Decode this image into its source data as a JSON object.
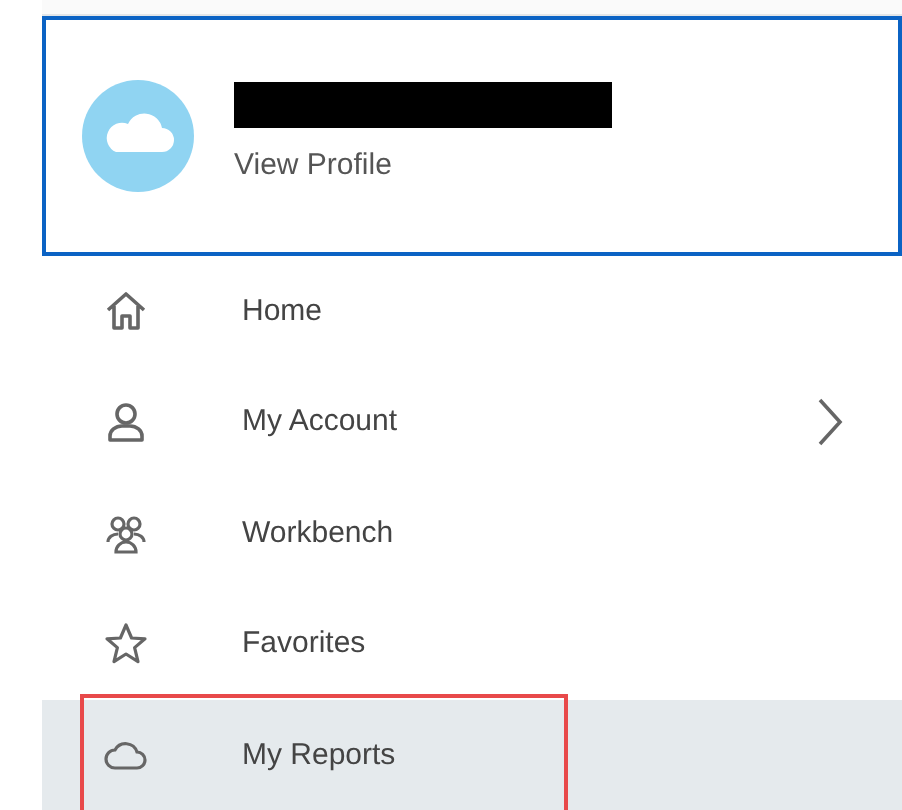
{
  "profile": {
    "link": "View Profile"
  },
  "menu": [
    {
      "kind": "home",
      "label": "Home",
      "selected": false,
      "submenu": false,
      "outlined": false
    },
    {
      "kind": "person",
      "label": "My Account",
      "selected": false,
      "submenu": true,
      "outlined": false
    },
    {
      "kind": "people",
      "label": "Workbench",
      "selected": false,
      "submenu": false,
      "outlined": false
    },
    {
      "kind": "star",
      "label": "Favorites",
      "selected": false,
      "submenu": false,
      "outlined": false
    },
    {
      "kind": "cloud",
      "label": "My Reports",
      "selected": true,
      "submenu": false,
      "outlined": true
    }
  ]
}
